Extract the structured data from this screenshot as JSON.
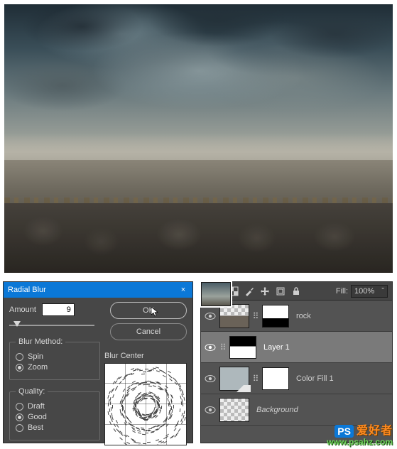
{
  "watermark": {
    "brand_cn": "爱好者",
    "url": "www.psahz.com",
    "ps": "PS"
  },
  "dialog": {
    "title": "Radial Blur",
    "close": "×",
    "amount_label": "Amount",
    "amount_value": "9",
    "ok_label": "OK",
    "cancel_label": "Cancel",
    "method_legend": "Blur Method:",
    "method_spin": "Spin",
    "method_zoom": "Zoom",
    "quality_legend": "Quality:",
    "quality_draft": "Draft",
    "quality_good": "Good",
    "quality_best": "Best",
    "center_label": "Blur Center"
  },
  "layers_panel": {
    "lock_label": "Lock:",
    "fill_label": "Fill:",
    "fill_value": "100%",
    "rows": [
      {
        "name": "rock"
      },
      {
        "name": "Layer 1"
      },
      {
        "name": "Color Fill 1"
      },
      {
        "name": "Background"
      }
    ]
  }
}
